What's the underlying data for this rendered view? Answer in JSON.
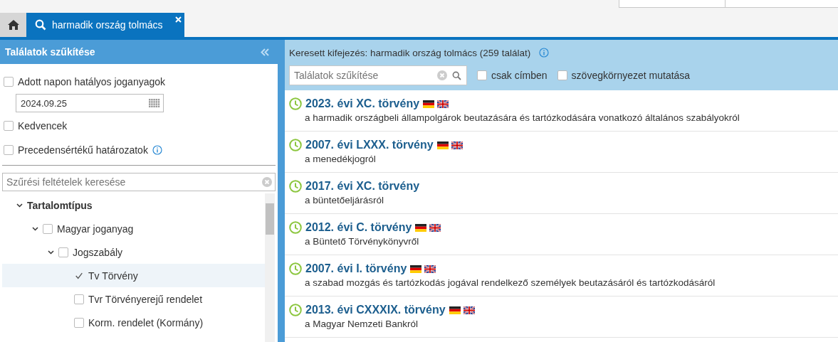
{
  "tabs": [
    {
      "kind": "home",
      "selected": false
    },
    {
      "kind": "search",
      "label": "harmadik ország tolmács",
      "selected": true,
      "closable": true
    }
  ],
  "sidebar": {
    "title": "Találatok szűkítése",
    "options": [
      {
        "kind": "checkbox",
        "label": "Adott napon hatályos joganyagok",
        "checked": false
      },
      {
        "kind": "date",
        "value": "2024.09.25"
      },
      {
        "kind": "checkbox",
        "label": "Kedvencek",
        "checked": false
      },
      {
        "kind": "checkbox",
        "label": "Precedensértékű határozatok",
        "checked": false,
        "info": true
      }
    ],
    "filter_search": {
      "placeholder": "Szűrési feltételek keresése"
    },
    "tree": [
      {
        "label": "Tartalomtípus",
        "kind": "heading",
        "expanded": true,
        "children": [
          {
            "label": "Magyar joganyag",
            "kind": "checkbox",
            "checked": false,
            "expanded": true,
            "selected": false,
            "children": [
              {
                "label": "Jogszabály",
                "kind": "checkbox",
                "checked": false,
                "expanded": true,
                "selected": false,
                "children": [
                  {
                    "label": "Tv Törvény",
                    "kind": "checkbox",
                    "checked": true,
                    "selected": true
                  },
                  {
                    "label": "Tvr Törvényerejű rendelet",
                    "kind": "checkbox",
                    "checked": false,
                    "selected": false
                  },
                  {
                    "label": "Korm. rendelet (Kormány)",
                    "kind": "checkbox",
                    "checked": false,
                    "selected": false
                  }
                ]
              }
            ]
          }
        ]
      }
    ]
  },
  "results_header": {
    "summary": "Keresett kifejezés: harmadik ország tolmács (259 találat)",
    "narrow_search": {
      "placeholder": "Találatok szűkítése"
    },
    "options": [
      {
        "label": "csak címben",
        "checked": false
      },
      {
        "label": "szövegkörnyezet mutatása",
        "checked": false
      }
    ]
  },
  "results": [
    {
      "title": "2023. évi XC. törvény",
      "flags": [
        {
          "kind": "german"
        },
        {
          "kind": "english"
        }
      ],
      "description": "a harmadik országbeli állampolgárok beutazására és tartózkodására vonatkozó általános szabályokról"
    },
    {
      "title": "2007. évi LXXX. törvény",
      "flags": [
        {
          "kind": "german"
        },
        {
          "kind": "english"
        }
      ],
      "description": "a menedékjogról"
    },
    {
      "title": "2017. évi XC. törvény",
      "description": "a büntetőeljárásról"
    },
    {
      "title": "2012. évi C. törvény",
      "flags": [
        {
          "kind": "german"
        },
        {
          "kind": "english"
        }
      ],
      "description": "a Büntető Törvénykönyvről"
    },
    {
      "title": "2007. évi I. törvény",
      "flags": [
        {
          "kind": "german"
        },
        {
          "kind": "english"
        }
      ],
      "description": "a szabad mozgás és tartózkodás jogával rendelkező személyek beutazásáról és tartózkodásáról"
    },
    {
      "title": "2013. évi CXXXIX. törvény",
      "flags": [
        {
          "kind": "german"
        },
        {
          "kind": "english"
        }
      ],
      "description": "a Magyar Nemzeti Bankról"
    }
  ]
}
